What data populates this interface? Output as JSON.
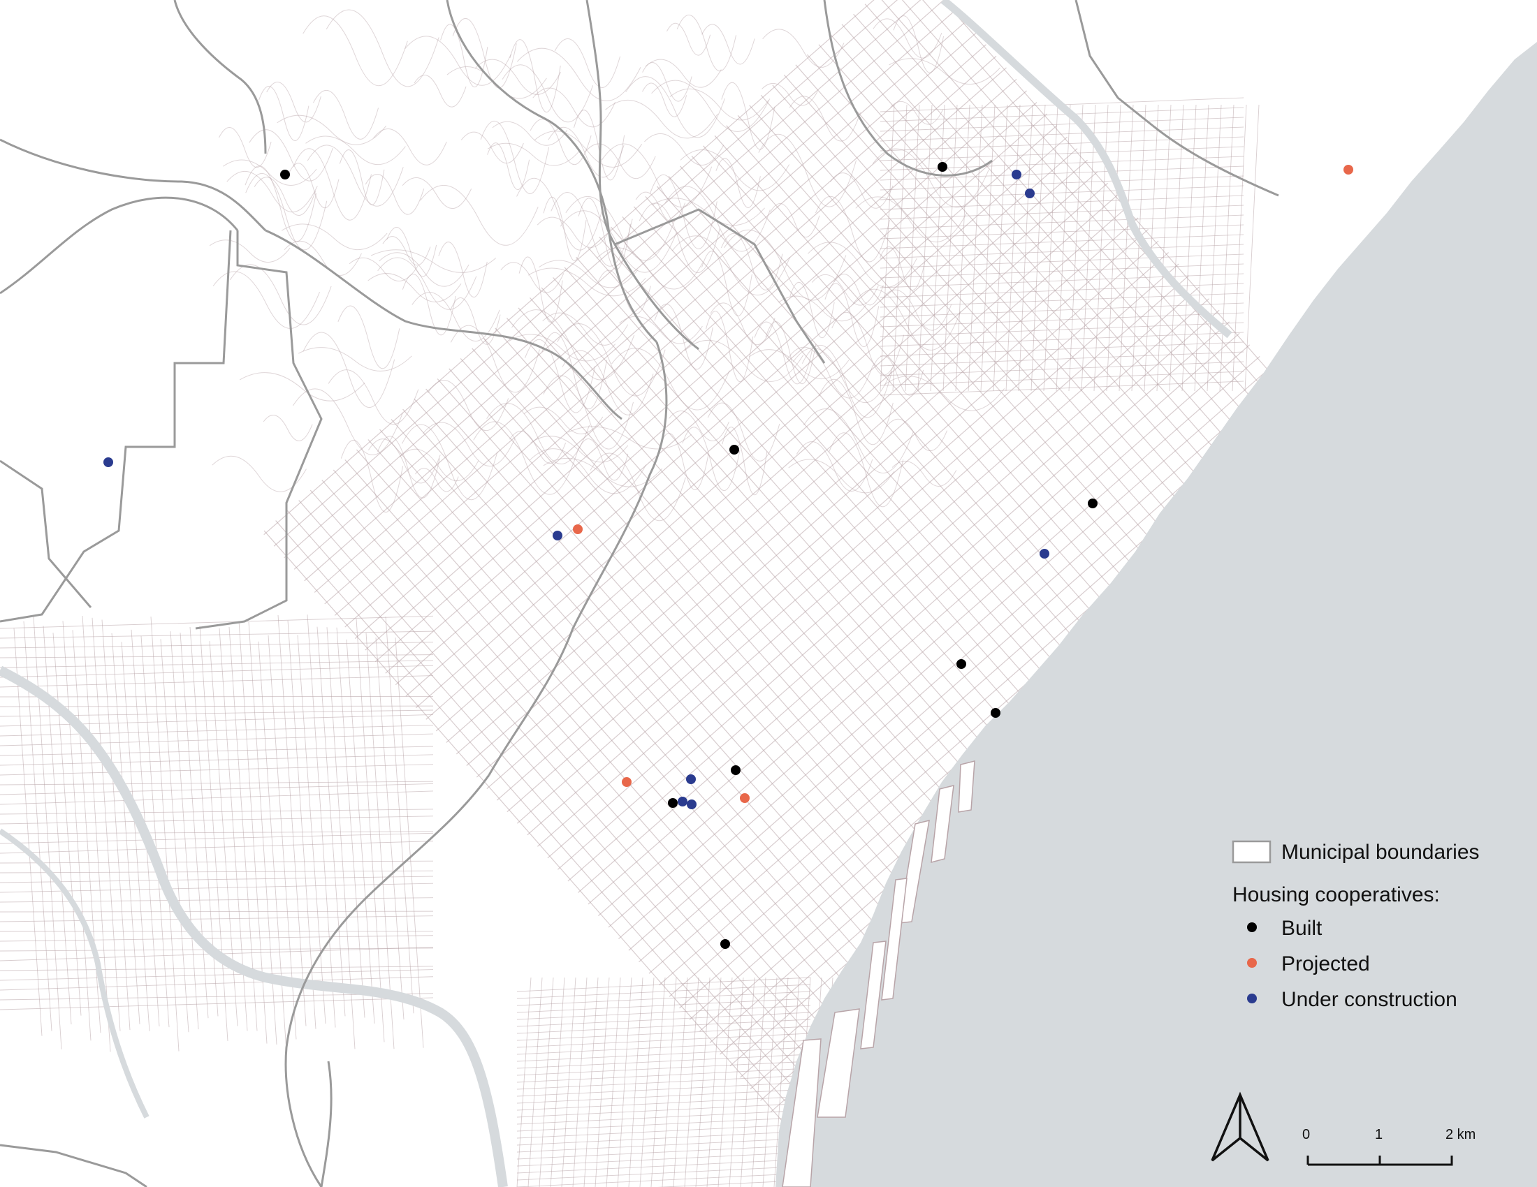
{
  "legend": {
    "boundaries_label": "Municipal boundaries",
    "cooperatives_title": "Housing cooperatives:",
    "categories": [
      {
        "key": "built",
        "label": "Built",
        "color": "#000000"
      },
      {
        "key": "projected",
        "label": "Projected",
        "color": "#e8674a"
      },
      {
        "key": "under_construction",
        "label": "Under construction",
        "color": "#2a3b8f"
      }
    ]
  },
  "scale_bar": {
    "ticks": [
      "0",
      "1",
      "2 km"
    ]
  },
  "north_arrow": {
    "icon": "north-arrow-icon"
  },
  "colors": {
    "sea": "#d6dadd",
    "land": "#ffffff",
    "streets": "#b8a4a8",
    "boundaries": "#9a9a9a",
    "river": "#d6dadd"
  }
}
